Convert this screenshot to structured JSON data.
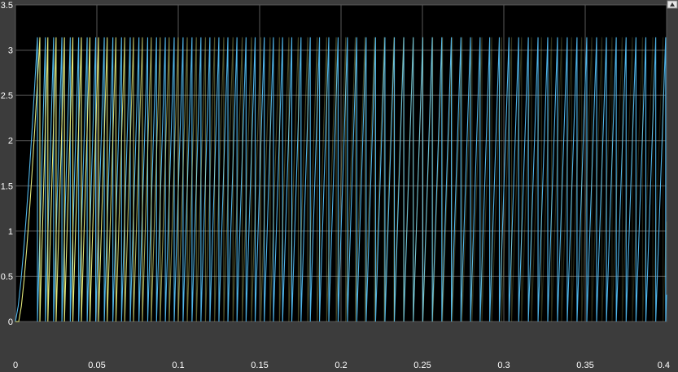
{
  "chart_data": {
    "type": "line",
    "title": "",
    "xlabel": "",
    "ylabel": "",
    "xlim": [
      0,
      0.4
    ],
    "ylim": [
      0,
      3.5
    ],
    "xticks": [
      "0",
      "0.05",
      "0.1",
      "0.15",
      "0.2",
      "0.25",
      "0.3",
      "0.35",
      "0.4"
    ],
    "yticks": [
      "0",
      "0.5",
      "1",
      "1.5",
      "2",
      "2.5",
      "3",
      "3.5"
    ],
    "grid": true,
    "background": "#000000",
    "series": [
      {
        "name": "",
        "color": "#4fb4e8",
        "shape": "sawtooth",
        "min": 0,
        "max": 3.1416,
        "ramp_start_x": 0.0,
        "first_wrap_x": 0.0135,
        "initial_period": 0.0049,
        "final_period": 0.0061,
        "period_model": "sub-linear"
      },
      {
        "name": "",
        "color": "#e3e87a",
        "shape": "sawtooth",
        "min": 0,
        "max": 3.1416,
        "ramp_start_x": 0.002,
        "first_wrap_x": 0.015,
        "initial_period": 0.0049,
        "final_period": 0.0063,
        "fade_end_x": 0.12,
        "period_model": "sub-linear"
      }
    ]
  },
  "expand_icon": "up-arrow-icon"
}
